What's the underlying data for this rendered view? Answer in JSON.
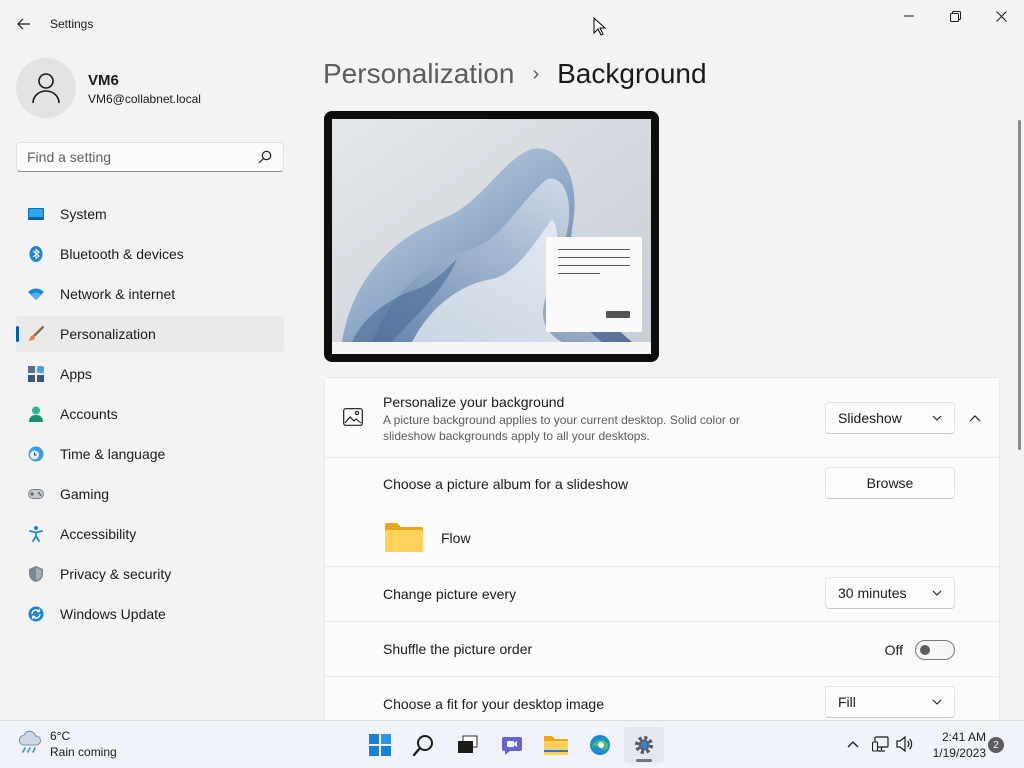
{
  "window": {
    "title": "Settings"
  },
  "user": {
    "name": "VM6",
    "email": "VM6@collabnet.local"
  },
  "search": {
    "placeholder": "Find a setting"
  },
  "sidebar": {
    "items": [
      {
        "label": "System",
        "icon": "system-icon"
      },
      {
        "label": "Bluetooth & devices",
        "icon": "bluetooth-icon"
      },
      {
        "label": "Network & internet",
        "icon": "wifi-icon"
      },
      {
        "label": "Personalization",
        "icon": "brush-icon"
      },
      {
        "label": "Apps",
        "icon": "apps-icon"
      },
      {
        "label": "Accounts",
        "icon": "accounts-icon"
      },
      {
        "label": "Time & language",
        "icon": "time-language-icon"
      },
      {
        "label": "Gaming",
        "icon": "gamepad-icon"
      },
      {
        "label": "Accessibility",
        "icon": "accessibility-icon"
      },
      {
        "label": "Privacy & security",
        "icon": "shield-icon"
      },
      {
        "label": "Windows Update",
        "icon": "update-icon"
      }
    ],
    "active_index": 3
  },
  "breadcrumb": {
    "parent": "Personalization",
    "separator": "›",
    "current": "Background"
  },
  "settings": {
    "personalize": {
      "label": "Personalize your background",
      "description": "A picture background applies to your current desktop. Solid color or slideshow backgrounds apply to all your desktops.",
      "value": "Slideshow"
    },
    "album": {
      "label": "Choose a picture album for a slideshow",
      "button": "Browse",
      "folder": "Flow"
    },
    "interval": {
      "label": "Change picture every",
      "value": "30 minutes"
    },
    "shuffle": {
      "label": "Shuffle the picture order",
      "state": "Off"
    },
    "fit": {
      "label": "Choose a fit for your desktop image",
      "value": "Fill"
    }
  },
  "taskbar": {
    "weather": {
      "temp": "6°C",
      "desc": "Rain coming"
    },
    "apps": [
      "start-icon",
      "search-icon",
      "task-view-icon",
      "chat-icon",
      "file-explorer-icon",
      "edge-icon",
      "settings-icon"
    ],
    "time": "2:41 AM",
    "date": "1/19/2023",
    "notification_count": "2"
  },
  "colors": {
    "accent": "#005fb8",
    "background": "#f3f3f3",
    "card": "#fbfbfb"
  }
}
